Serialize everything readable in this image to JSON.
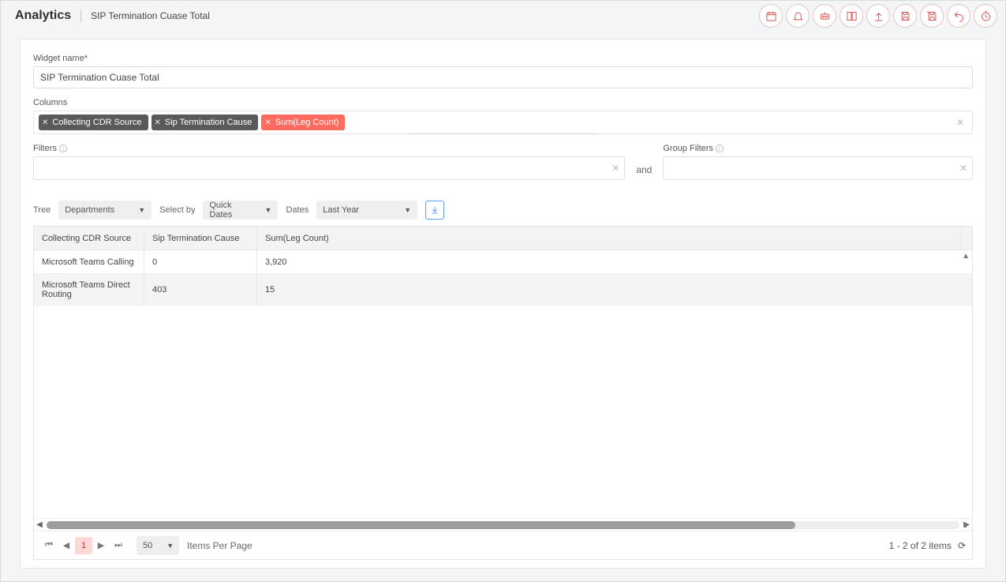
{
  "header": {
    "app_title": "Analytics",
    "breadcrumb": "SIP Termination Cuase Total"
  },
  "toolbar_icons": [
    "calendar-icon",
    "bell-icon",
    "robot-icon",
    "columns-icon",
    "upload-icon",
    "save-icon",
    "save-as-icon",
    "undo-icon",
    "timer-icon"
  ],
  "widget_name": {
    "label": "Widget name*",
    "value": "SIP Termination Cuase Total"
  },
  "columns": {
    "label": "Columns",
    "chips": [
      {
        "label": "Collecting CDR Source",
        "style": "dark"
      },
      {
        "label": "Sip Termination Cause",
        "style": "dark"
      },
      {
        "label": "Sum(Leg Count)",
        "style": "red"
      }
    ]
  },
  "filters": {
    "label": "Filters",
    "and_label": "and",
    "group_label": "Group Filters"
  },
  "selectors": {
    "tree_label": "Tree",
    "tree_value": "Departments",
    "select_by_label": "Select by",
    "select_by_value": "Quick Dates",
    "dates_label": "Dates",
    "dates_value": "Last Year"
  },
  "table": {
    "headers": {
      "col1": "Collecting CDR Source",
      "col2": "Sip Termination Cause",
      "col3": "Sum(Leg Count)"
    },
    "rows": [
      {
        "col1": "Microsoft Teams Calling",
        "col2": "0",
        "col3": "3,920"
      },
      {
        "col1": "Microsoft Teams Direct Routing",
        "col2": "403",
        "col3": "15"
      }
    ]
  },
  "footer": {
    "current_page": "1",
    "page_size": "50",
    "items_per_page_label": "Items Per Page",
    "range": "1 - 2 of 2 items"
  }
}
